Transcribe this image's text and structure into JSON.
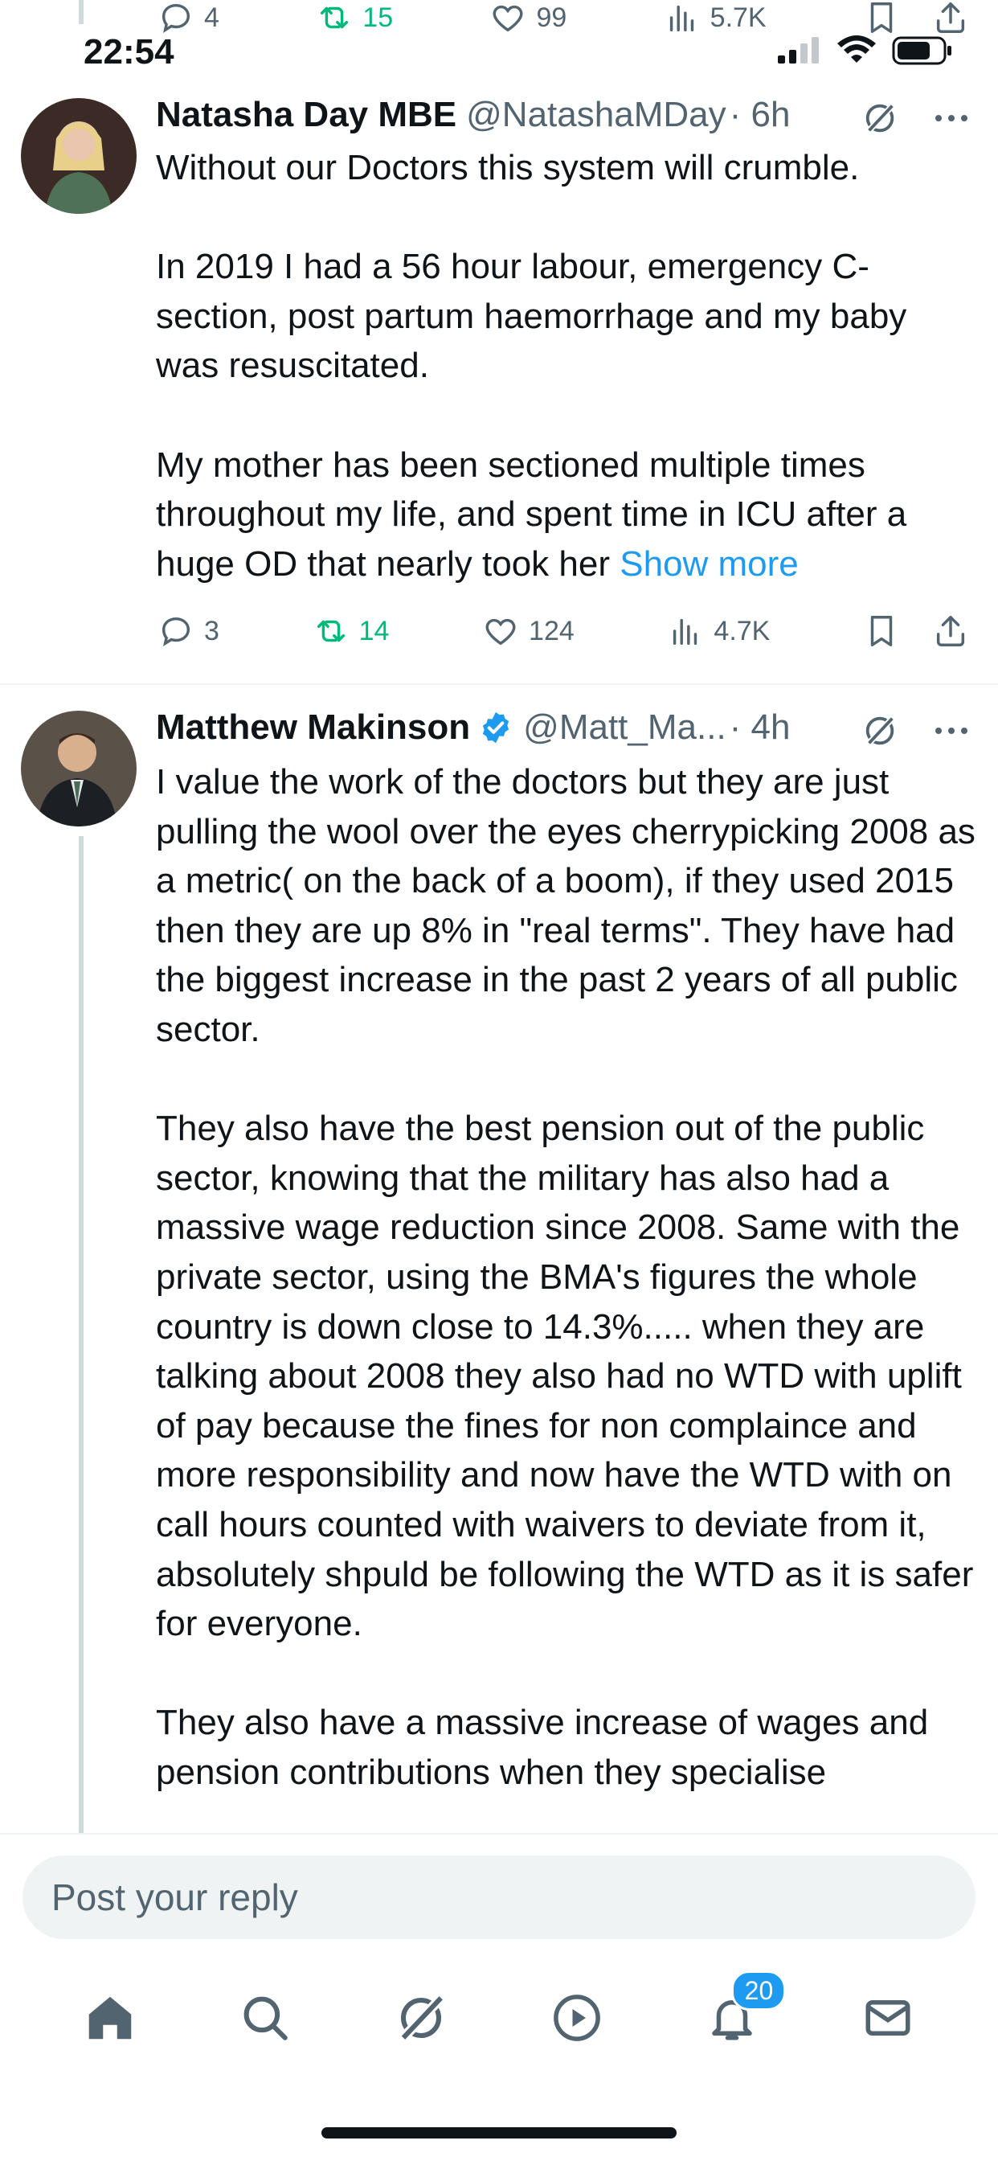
{
  "status_bar": {
    "time": "22:54"
  },
  "top_actions": {
    "replies": "4",
    "reposts": "15",
    "likes": "99",
    "views": "5.7K"
  },
  "tweets": [
    {
      "display_name": "Natasha Day MBE",
      "handle": "@NatashaMDay",
      "time": "· 6h",
      "paragraphs": [
        "Without our Doctors this system will crumble.",
        "In 2019 I had a 56 hour labour, emergency C-section, post partum haemorrhage and my baby was resuscitated.",
        "My mother has been sectioned multiple times throughout my life, and spent time in ICU after a huge OD that nearly took her"
      ],
      "show_more": "Show more",
      "replies": "3",
      "reposts": "14",
      "likes": "124",
      "views": "4.7K"
    },
    {
      "display_name": "Matthew Makinson",
      "handle": "@Matt_Ma...",
      "time": "· 4h",
      "paragraphs": [
        "I value the work of the doctors but they are just pulling the wool over the eyes cherrypicking 2008 as a metric( on the back of a boom), if they used 2015 then they are up 8% in \"real terms\". They have had the biggest increase in the past 2 years of all public sector.",
        "They also have the best pension out of the public sector, knowing that the military has also had a massive wage reduction since 2008. Same with the private sector, using the BMA's figures the whole country is down close to 14.3%..... when they are talking about 2008 they also had no WTD with uplift of pay because the fines for non complaince and more responsibility and now have the WTD with on call hours counted with waivers to deviate from it, absolutely shpuld be following the WTD as it is safer for everyone.",
        "They also have a massive increase of wages and pension contributions when they specialise"
      ]
    }
  ],
  "reply": {
    "placeholder": "Post your reply"
  },
  "nav": {
    "notifications_badge": "20"
  },
  "colors": {
    "accent": "#1d9bf0",
    "repost_green": "#00ba7c",
    "muted": "#536471"
  }
}
